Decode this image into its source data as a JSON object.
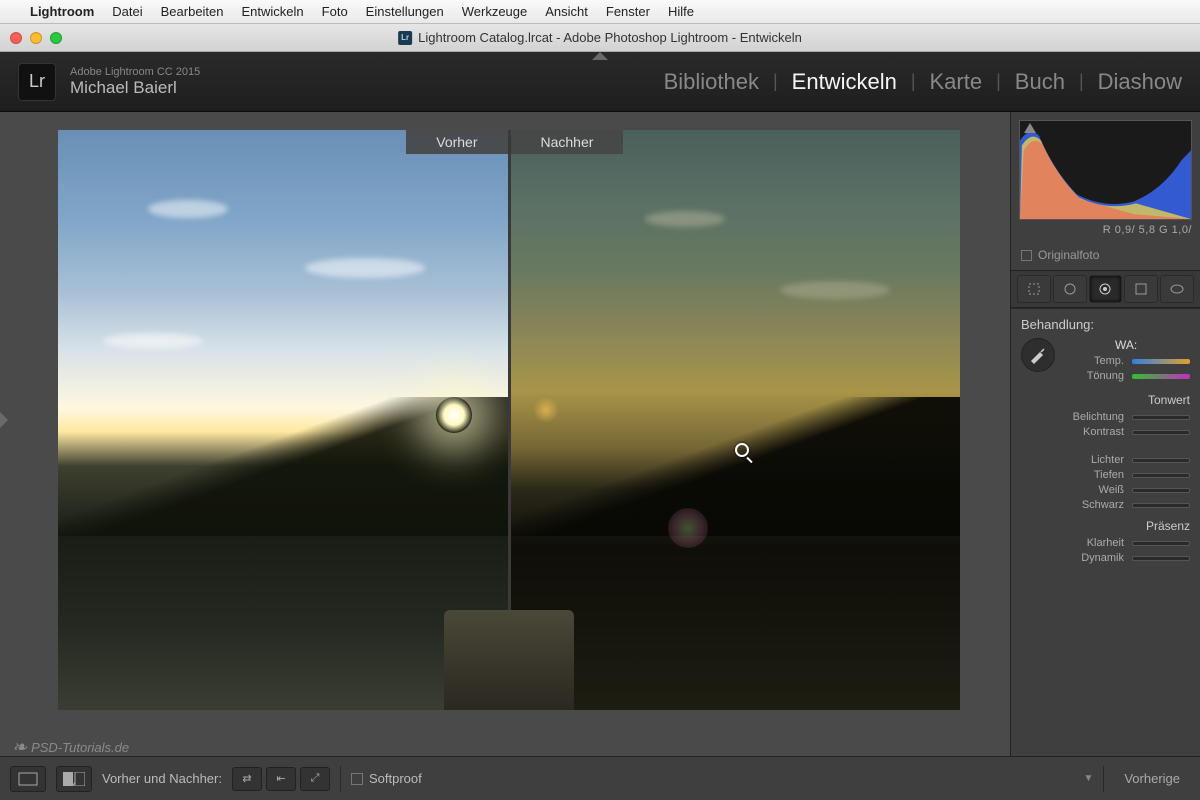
{
  "menubar": {
    "app": "Lightroom",
    "items": [
      "Datei",
      "Bearbeiten",
      "Entwickeln",
      "Foto",
      "Einstellungen",
      "Werkzeuge",
      "Ansicht",
      "Fenster",
      "Hilfe"
    ]
  },
  "window": {
    "title": "Lightroom Catalog.lrcat - Adobe Photoshop Lightroom - Entwickeln"
  },
  "header": {
    "logo": "Lr",
    "version": "Adobe Lightroom CC 2015",
    "user": "Michael Baierl",
    "modules": [
      "Bibliothek",
      "Entwickeln",
      "Karte",
      "Buch",
      "Diashow"
    ],
    "active_module": "Entwickeln"
  },
  "compare": {
    "before": "Vorher",
    "after": "Nachher"
  },
  "right": {
    "histogram_readout": "R   0,9/   5,8   G   1,0/",
    "originalfoto": "Originalfoto",
    "behandlung": "Behandlung:",
    "wa": "WA:",
    "sliders": {
      "temp": "Temp.",
      "tint": "Tönung",
      "tonwert": "Tonwert",
      "belichtung": "Belichtung",
      "kontrast": "Kontrast",
      "lichter": "Lichter",
      "tiefen": "Tiefen",
      "weiss": "Weiß",
      "schwarz": "Schwarz",
      "prasenz": "Präsenz",
      "klarheit": "Klarheit",
      "dynamik": "Dynamik"
    },
    "vorherige": "Vorherige"
  },
  "bottom": {
    "label": "Vorher und Nachher:",
    "softproof": "Softproof"
  },
  "watermark": "PSD-Tutorials.de"
}
